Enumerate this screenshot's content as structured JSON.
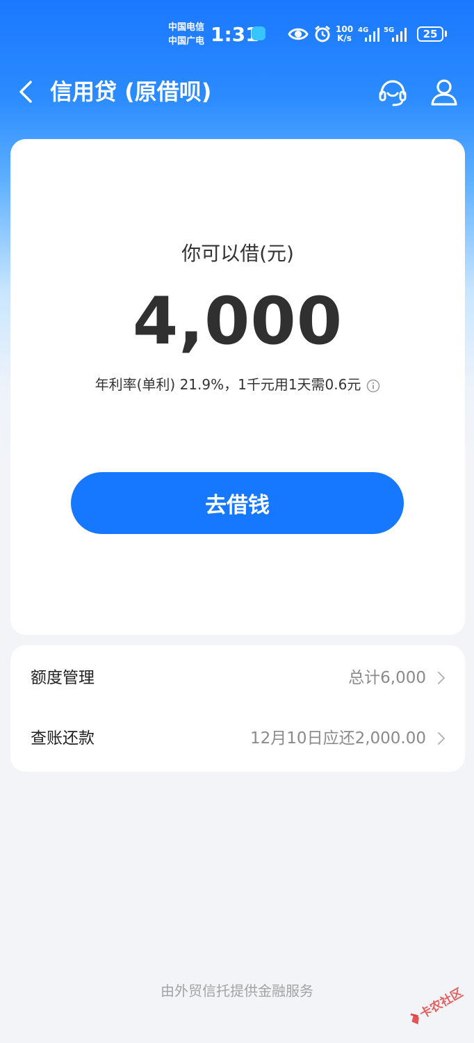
{
  "status_bar": {
    "carrier_1": "中国电信",
    "carrier_2": "中国广电",
    "time": "1:31",
    "net_speed_value": "100",
    "net_speed_unit": "K/s",
    "signal_1": "4G",
    "signal_2": "5G",
    "battery": "25"
  },
  "header": {
    "title": "信用贷 (原借呗)",
    "back_icon": "chevron-left-icon",
    "service_icon": "headset-icon",
    "user_icon": "user-icon"
  },
  "loan": {
    "label": "你可以借(元)",
    "amount": "4,000",
    "rate_text": "年利率(单利) 21.9%，1千元用1天需0.6元",
    "borrow_button": "去借钱"
  },
  "menu": {
    "items": [
      {
        "label": "额度管理",
        "value": "总计6,000"
      },
      {
        "label": "查账还款",
        "value": "12月10日应还2,000.00"
      }
    ]
  },
  "footer": {
    "text": "由外贸信托提供金融服务"
  },
  "watermark": {
    "text": "卡农社区"
  },
  "colors": {
    "brand": "#1677ff",
    "header_blue": "#1a78ff",
    "page_bg": "#f3f4f8"
  }
}
